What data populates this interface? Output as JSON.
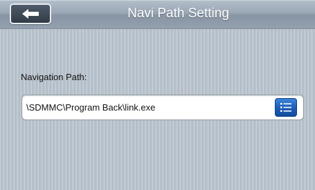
{
  "header": {
    "title": "Navi Path Setting",
    "back_icon": "arrow-left-icon"
  },
  "main": {
    "path_label": "Navigation Path:",
    "path_value": "\\SDMMC\\Program Back\\link.exe",
    "browse_icon": "list-icon"
  },
  "colors": {
    "title_bar": "#9aa7b5",
    "background": "#b9c3cd",
    "browse_button": "#1b5cb8"
  }
}
